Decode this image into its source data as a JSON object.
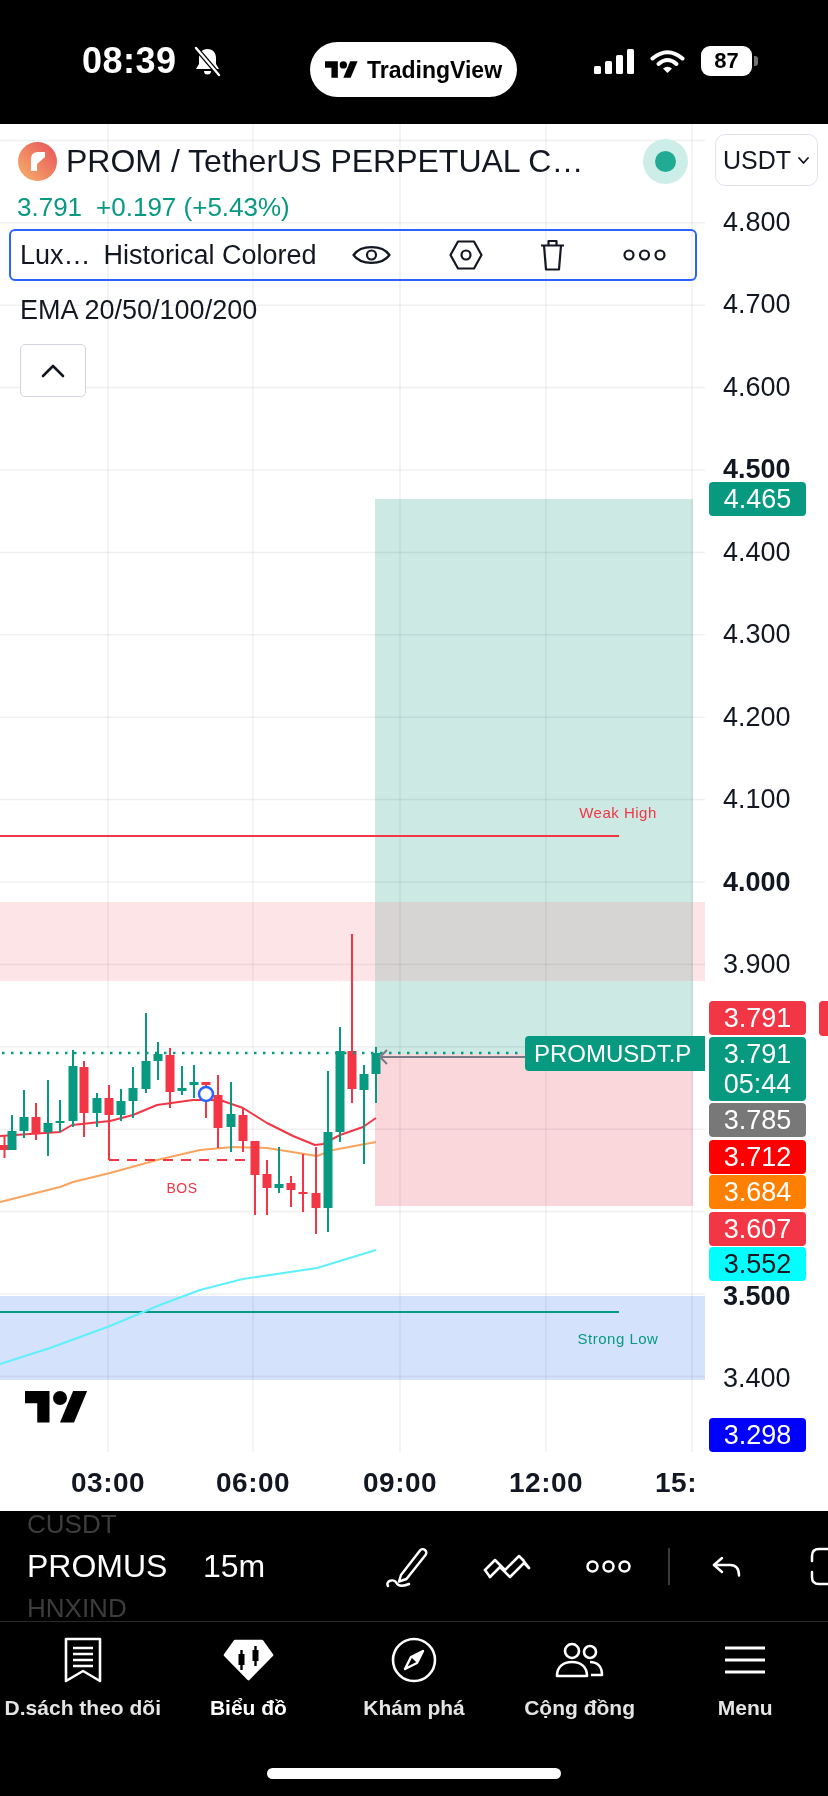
{
  "status_bar": {
    "time": "08:39",
    "app": "TradingView",
    "battery": "87"
  },
  "chart": {
    "symbol": {
      "title": "PROM / TetherUS PERPETUAL C…",
      "price": "3.791",
      "change": "+0.197 (+5.43%)"
    },
    "indicators": [
      {
        "name": "Lux…",
        "settings": "Historical Colored",
        "selected": true
      },
      {
        "name": "EMA 20/50/100/200",
        "selected": false
      }
    ],
    "legend": {
      "expanded": true
    },
    "currency": "USDT",
    "zone_labels": [
      {
        "text": "Weak High",
        "kind": "high"
      },
      {
        "text": "Strong Low",
        "kind": "low"
      }
    ],
    "structure_label": "BOS",
    "symbol_label": "PROMUSDT.P",
    "price_ticks": [
      {
        "text": "4.800",
        "major": false
      },
      {
        "text": "4.700",
        "major": false
      },
      {
        "text": "4.600",
        "major": false
      },
      {
        "text": "4.500",
        "major": true
      },
      {
        "text": "4.400",
        "major": false
      },
      {
        "text": "4.300",
        "major": false
      },
      {
        "text": "4.200",
        "major": false
      },
      {
        "text": "4.100",
        "major": false
      },
      {
        "text": "4.000",
        "major": true
      },
      {
        "text": "3.900",
        "major": false
      },
      {
        "text": "3.500",
        "major": true
      },
      {
        "text": "3.400",
        "major": false
      }
    ],
    "price_badges": [
      {
        "text": "4.465",
        "color": "#089981"
      },
      {
        "text": "3.791",
        "color": "#f23645"
      },
      {
        "text": "3.791",
        "countdown": "05:44",
        "color": "#089981"
      },
      {
        "text": "3.785",
        "color": "#787878"
      },
      {
        "text": "3.712",
        "color": "#ff0000"
      },
      {
        "text": "3.684",
        "color": "#ff7f00"
      },
      {
        "text": "3.607",
        "color": "#f23645"
      },
      {
        "text": "3.552",
        "color": "#00ffff"
      },
      {
        "text": "3.298",
        "color": "#0000ff"
      }
    ],
    "time_ticks": [
      "03:00",
      "06:00",
      "09:00",
      "12:00",
      "15:"
    ]
  },
  "toolbar": {
    "symbols": [
      {
        "text": "CUSDT",
        "selected": false
      },
      {
        "text": "PROMUS",
        "selected": true
      },
      {
        "text": "HNXIND",
        "selected": false
      }
    ],
    "interval": "15m"
  },
  "tab_bar": [
    {
      "label": "D.sách theo dõi",
      "selected": false,
      "kind": "watchlist"
    },
    {
      "label": "Biểu đồ",
      "selected": true,
      "kind": "chart"
    },
    {
      "label": "Khám phá",
      "selected": false,
      "kind": "explore"
    },
    {
      "label": "Cộng đồng",
      "selected": false,
      "kind": "community"
    },
    {
      "label": "Menu",
      "selected": false,
      "kind": "menu"
    }
  ]
}
